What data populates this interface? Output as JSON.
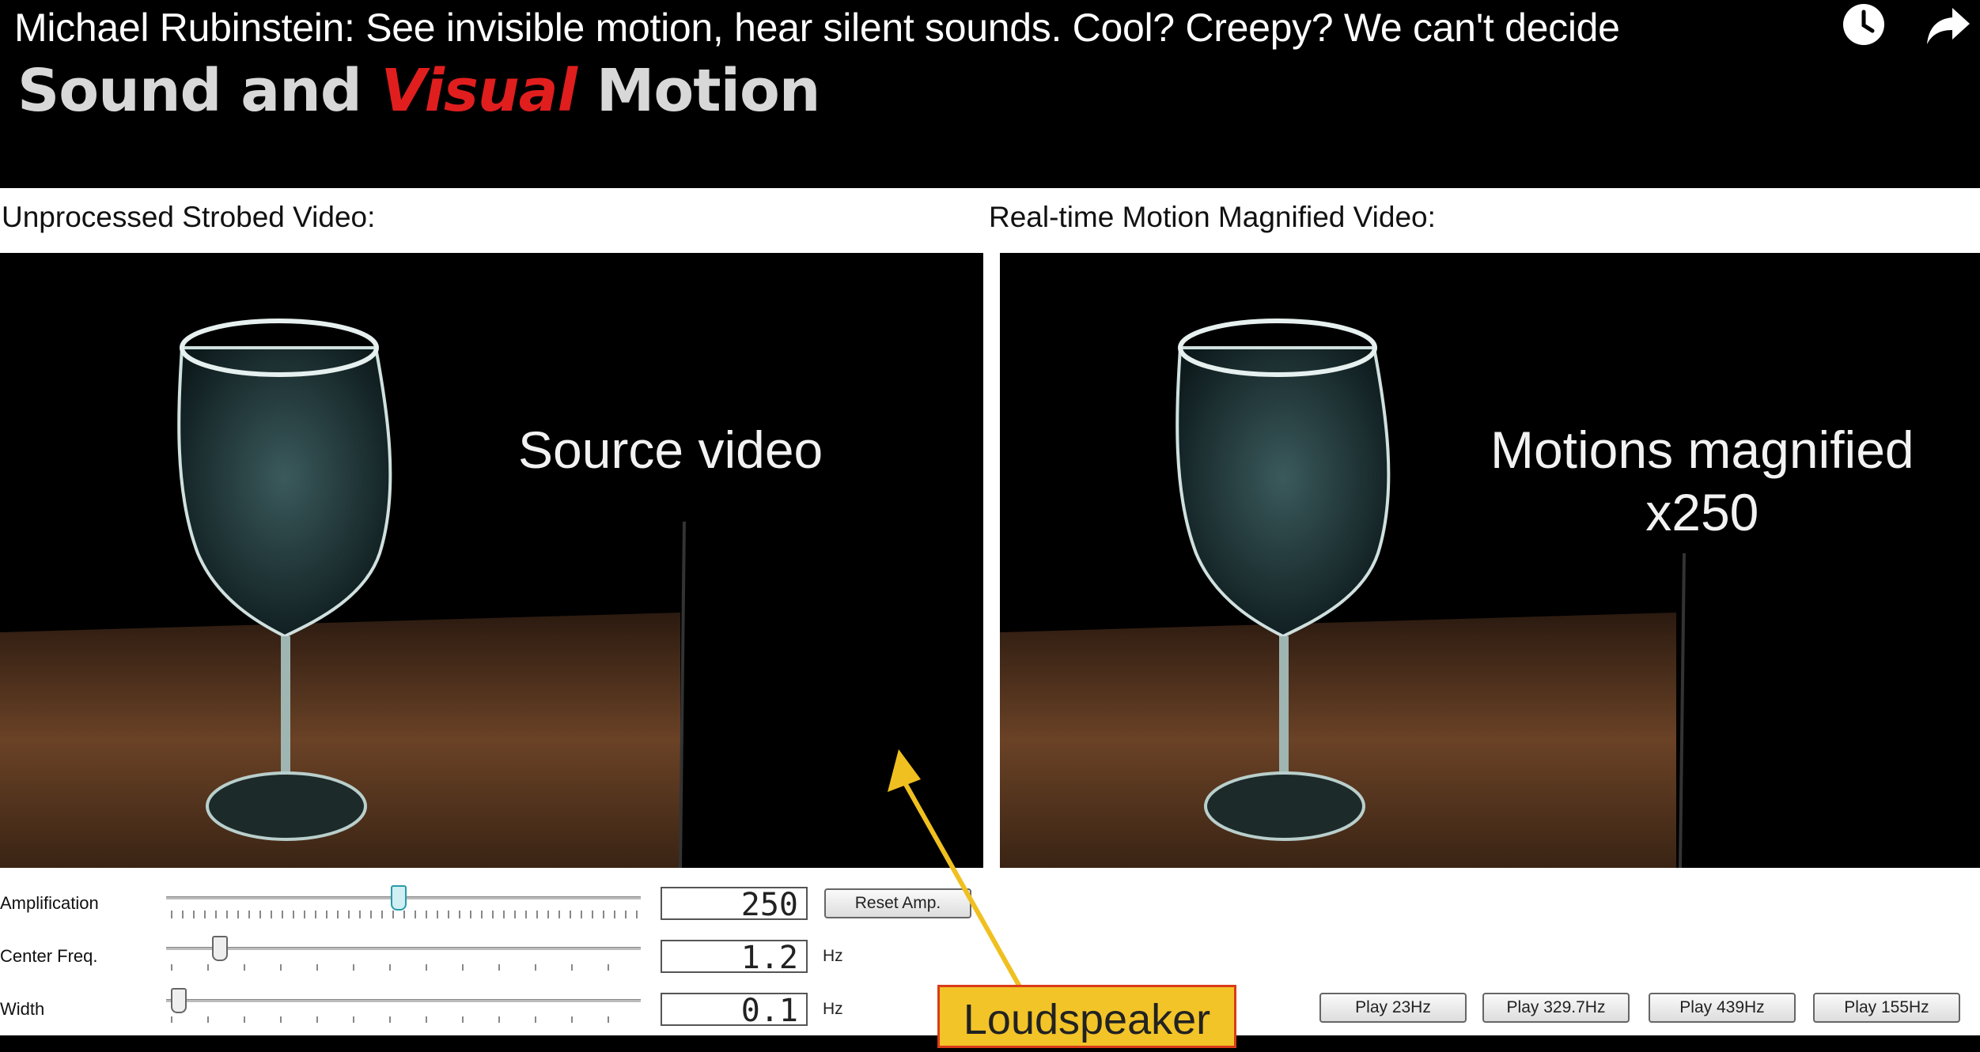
{
  "video": {
    "title": "Michael Rubinstein: See invisible motion, hear silent sounds. Cool? Creepy? We can't decide",
    "icons": {
      "watch_later": "clock-icon",
      "share": "share-arrow-icon"
    }
  },
  "slide": {
    "heading_part1": "Sound and ",
    "heading_accent": "Visual",
    "heading_part2": " Motion",
    "accent_color": "#e01e1e"
  },
  "app": {
    "left_panel_label": "Unprocessed Strobed Video:",
    "right_panel_label": "Real-time Motion Magnified Video:",
    "left_overlay": "Source video",
    "right_overlay_line1": "Motions magnified",
    "right_overlay_line2": "x250",
    "controls": [
      {
        "label": "Amplification",
        "value": "250",
        "unit": "",
        "slider_fraction": 0.49
      },
      {
        "label": "Center Freq.",
        "value": "1.2",
        "unit": "Hz",
        "slider_fraction": 0.1
      },
      {
        "label": "Width",
        "value": "0.1",
        "unit": "Hz",
        "slider_fraction": 0.01
      }
    ],
    "reset_button": "Reset Amp.",
    "play_buttons": [
      "Play 23Hz",
      "Play 329.7Hz",
      "Play 439Hz",
      "Play 155Hz"
    ],
    "callout": "Loudspeaker",
    "callout_colors": {
      "fill": "#f3c428",
      "border": "#d93c19",
      "arrow": "#f0c020"
    }
  }
}
